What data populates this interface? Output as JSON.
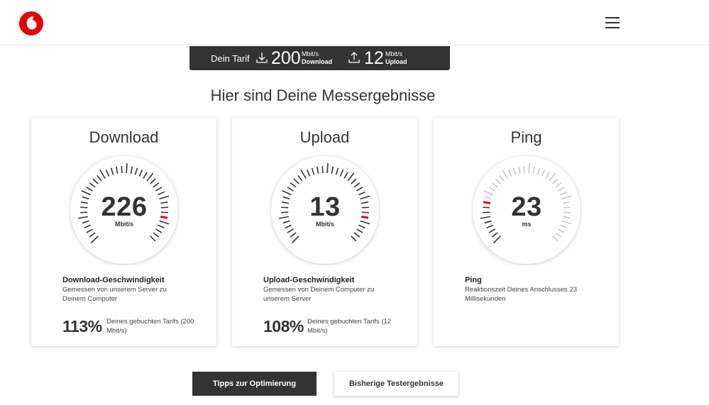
{
  "header": {
    "logo_icon": "vodafone-logo-icon",
    "menu_icon": "hamburger-menu-icon"
  },
  "tariff": {
    "label": "Dein Tarif",
    "download": {
      "value": "200",
      "unit": "Mbit/s",
      "kind": "Download"
    },
    "upload": {
      "value": "12",
      "unit": "Mbit/s",
      "kind": "Upload"
    }
  },
  "headline": "Hier sind Deine Messergebnisse",
  "cards": [
    {
      "title": "Download",
      "value": "226",
      "unit": "Mbit/s",
      "gauge_fraction": 0.87,
      "desc_title": "Download-Geschwindigkeit",
      "desc_text": "Gemessen von unserem Server zu Deinem Computer",
      "percent": "113%",
      "percent_note": "Deines gebuchten Tarifs (200 Mbit/s)"
    },
    {
      "title": "Upload",
      "value": "13",
      "unit": "Mbit/s",
      "gauge_fraction": 0.87,
      "desc_title": "Upload-Geschwindigkeit",
      "desc_text": "Gemessen von Deinem Computer zu unserem Server",
      "percent": "108%",
      "percent_note": "Deines gebuchten Tarifs (12 Mbit/s)"
    },
    {
      "title": "Ping",
      "value": "23",
      "unit": "ms",
      "gauge_fraction": 0.21,
      "desc_title": "Ping",
      "desc_text": "Reaktionszeit Deines Anschlusses 23 Millisekunden",
      "percent": "",
      "percent_note": ""
    }
  ],
  "buttons": {
    "tips": "Tipps zur Optimierung",
    "history": "Bisherige Testergebnisse"
  },
  "colors": {
    "accent": "#e60000",
    "dark": "#333333"
  }
}
